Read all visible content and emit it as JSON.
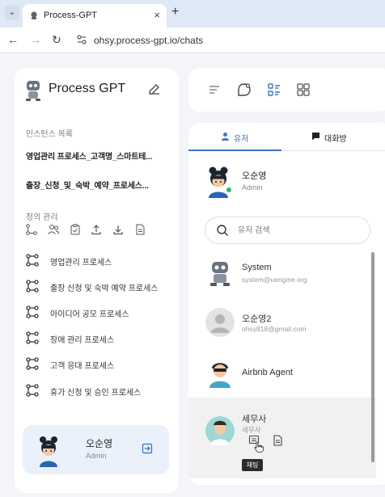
{
  "browser": {
    "tab_title": "Process-GPT",
    "url": "ohsy.process-gpt.io/chats",
    "new_tab": "+",
    "close_tab": "×"
  },
  "sidebar": {
    "brand": "Process GPT",
    "instances_title": "인스턴스 목록",
    "instances": [
      "영업관리 프로세스_고객명_스마트테...",
      "출장_신청_및_숙박_예약_프로세스..."
    ],
    "definitions_title": "정의 관리",
    "tool_icons": [
      "process-map-icon",
      "users-icon",
      "calendar-clipboard-icon",
      "upload-icon",
      "download-icon",
      "document-icon"
    ],
    "processes": [
      "영업관리 프로세스",
      "출장 신청 및 숙박 예약 프로세스",
      "아이디어 공모 프로세스",
      "장애 관리 프로세스",
      "고객 응대 프로세스",
      "휴가 신청 및 승인 프로세스"
    ],
    "user": {
      "name": "오순영",
      "role": "Admin"
    }
  },
  "chat_panel": {
    "tabs": {
      "users": "유저",
      "chatrooms": "대화방"
    },
    "me": {
      "name": "오순영",
      "role": "Admin"
    },
    "search_placeholder": "유저 검색",
    "users": [
      {
        "name": "System",
        "email": "system@uengine.org"
      },
      {
        "name": "오순영2",
        "email": "ohsy818@gmail.com"
      },
      {
        "name": "Airbnb Agent",
        "email": ""
      },
      {
        "name": "세무사",
        "email": "세무사"
      }
    ],
    "tooltip": "채팅"
  },
  "colors": {
    "accent": "#3a76c8",
    "card_bg": "#eaf1fb",
    "page_bg": "#f3f5f8"
  }
}
